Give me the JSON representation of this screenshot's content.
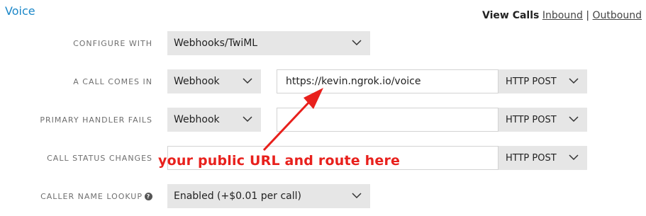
{
  "section": {
    "title": "Voice"
  },
  "header": {
    "view_calls": "View Calls",
    "inbound": "Inbound",
    "separator": "|",
    "outbound": "Outbound"
  },
  "rows": {
    "configure_with": {
      "label": "CONFIGURE WITH",
      "value": "Webhooks/TwiML"
    },
    "call_comes_in": {
      "label": "A CALL COMES IN",
      "type": "Webhook",
      "url": "https://kevin.ngrok.io/voice",
      "method": "HTTP POST"
    },
    "primary_handler_fails": {
      "label": "PRIMARY HANDLER FAILS",
      "type": "Webhook",
      "url": "",
      "method": "HTTP POST"
    },
    "call_status_changes": {
      "label": "CALL STATUS CHANGES",
      "url": "",
      "method": "HTTP POST"
    },
    "caller_name_lookup": {
      "label": "CALLER NAME LOOKUP",
      "help": "?",
      "value": "Enabled (+$0.01 per call)"
    }
  },
  "annotation": {
    "text": "your public URL and route here",
    "color": "#e8201c"
  },
  "colors": {
    "accent": "#1b87c8",
    "select_bg": "#e6e6e6",
    "label": "#6f6f6f"
  },
  "icons": {
    "dropdown": "chevron-down-icon",
    "help": "question-circle-icon",
    "arrow": "red-arrow"
  }
}
